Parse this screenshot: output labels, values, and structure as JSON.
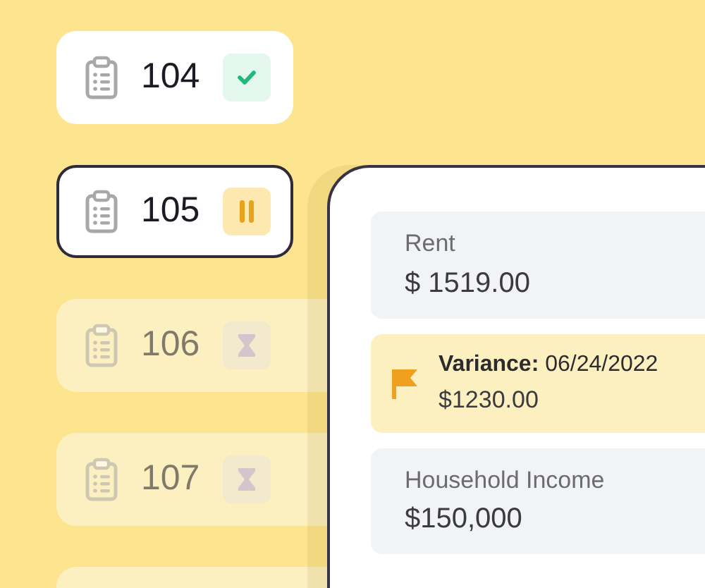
{
  "tickets": [
    {
      "kind": "done",
      "label": "104",
      "selected": false,
      "dimmed": false
    },
    {
      "kind": "paused",
      "label": "105",
      "selected": true,
      "dimmed": false
    },
    {
      "kind": "pending",
      "label": "106",
      "selected": false,
      "dimmed": true
    },
    {
      "kind": "pending",
      "label": "107",
      "selected": false,
      "dimmed": true
    },
    {
      "kind": "cut-off",
      "selected": false,
      "dimmed": true
    }
  ],
  "details": [
    {
      "kind": "field",
      "label": "Rent",
      "value": "$ 1519.00"
    },
    {
      "kind": "flag",
      "label": "**Variance:** 06/24/2022",
      "value": "$1230.00"
    },
    {
      "kind": "field",
      "label": "Household Income",
      "value": "$150,000"
    }
  ]
}
